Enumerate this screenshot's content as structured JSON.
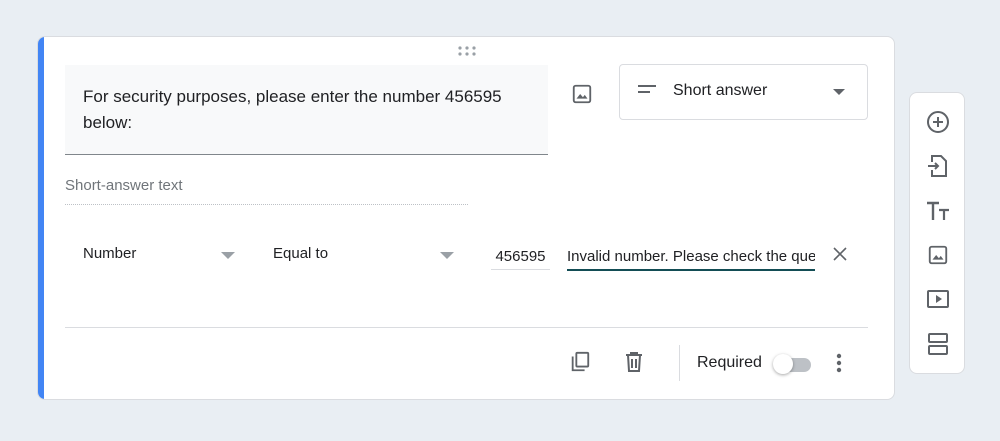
{
  "question": {
    "title": "For security purposes, please enter the number 456595 below:",
    "type_label": "Short answer",
    "answer_hint": "Short-answer text"
  },
  "validation": {
    "type": "Number",
    "condition": "Equal to",
    "value": "456595",
    "error_text": "Invalid number. Please check the ques"
  },
  "footer": {
    "required_label": "Required",
    "required": false
  },
  "icons": {
    "add_image": "image-icon",
    "type": "short-answer-lines-icon",
    "duplicate": "copy-icon",
    "delete": "trash-icon",
    "more": "more-vert-icon",
    "close": "close-icon",
    "toolbar": [
      "add-circle-icon",
      "import-icon",
      "title-text-icon",
      "image-icon",
      "video-icon",
      "section-icon"
    ]
  },
  "colors": {
    "accent": "#4285f4",
    "icon": "#5f6368",
    "error_underline": "#134d55"
  }
}
